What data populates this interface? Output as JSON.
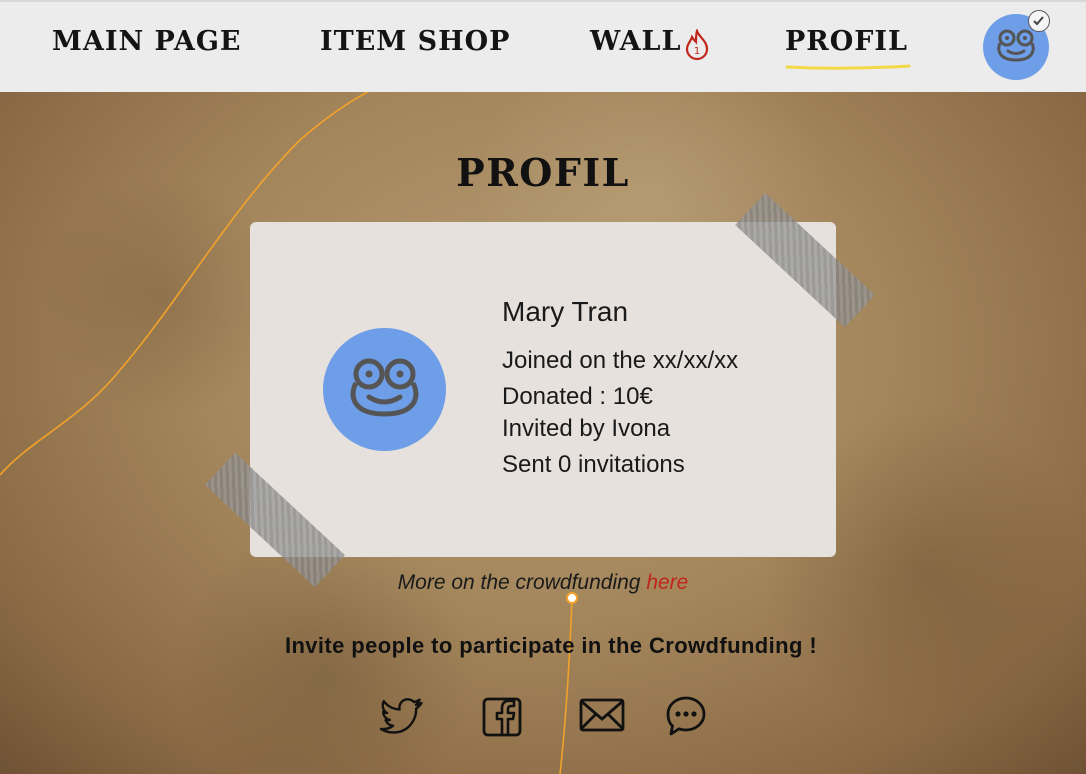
{
  "nav": {
    "items": [
      {
        "label": "MAIN PAGE"
      },
      {
        "label": "ITEM SHOP"
      },
      {
        "label": "WALL"
      },
      {
        "label": "PROFIL"
      }
    ],
    "wall_badge": "1",
    "active": "PROFIL"
  },
  "page": {
    "title": "PROFIL"
  },
  "profile": {
    "name": "Mary Tran",
    "joined": "Joined on the xx/xx/xx",
    "donated": "Donated : 10€",
    "invited_by": "Invited by Ivona",
    "sent": "Sent 0 invitations"
  },
  "crowdfunding": {
    "text": "More on the crowdfunding ",
    "link": "here"
  },
  "invite": {
    "heading": "Invite people to participate in the Crowdfunding !",
    "share_icons": [
      "twitter-icon",
      "facebook-icon",
      "mail-icon",
      "chat-icon"
    ]
  },
  "colors": {
    "accent_blue": "#6f9ee8",
    "link_red": "#c0261b",
    "underline_yellow": "#f2d94a",
    "thread_orange": "#f2a22a"
  }
}
